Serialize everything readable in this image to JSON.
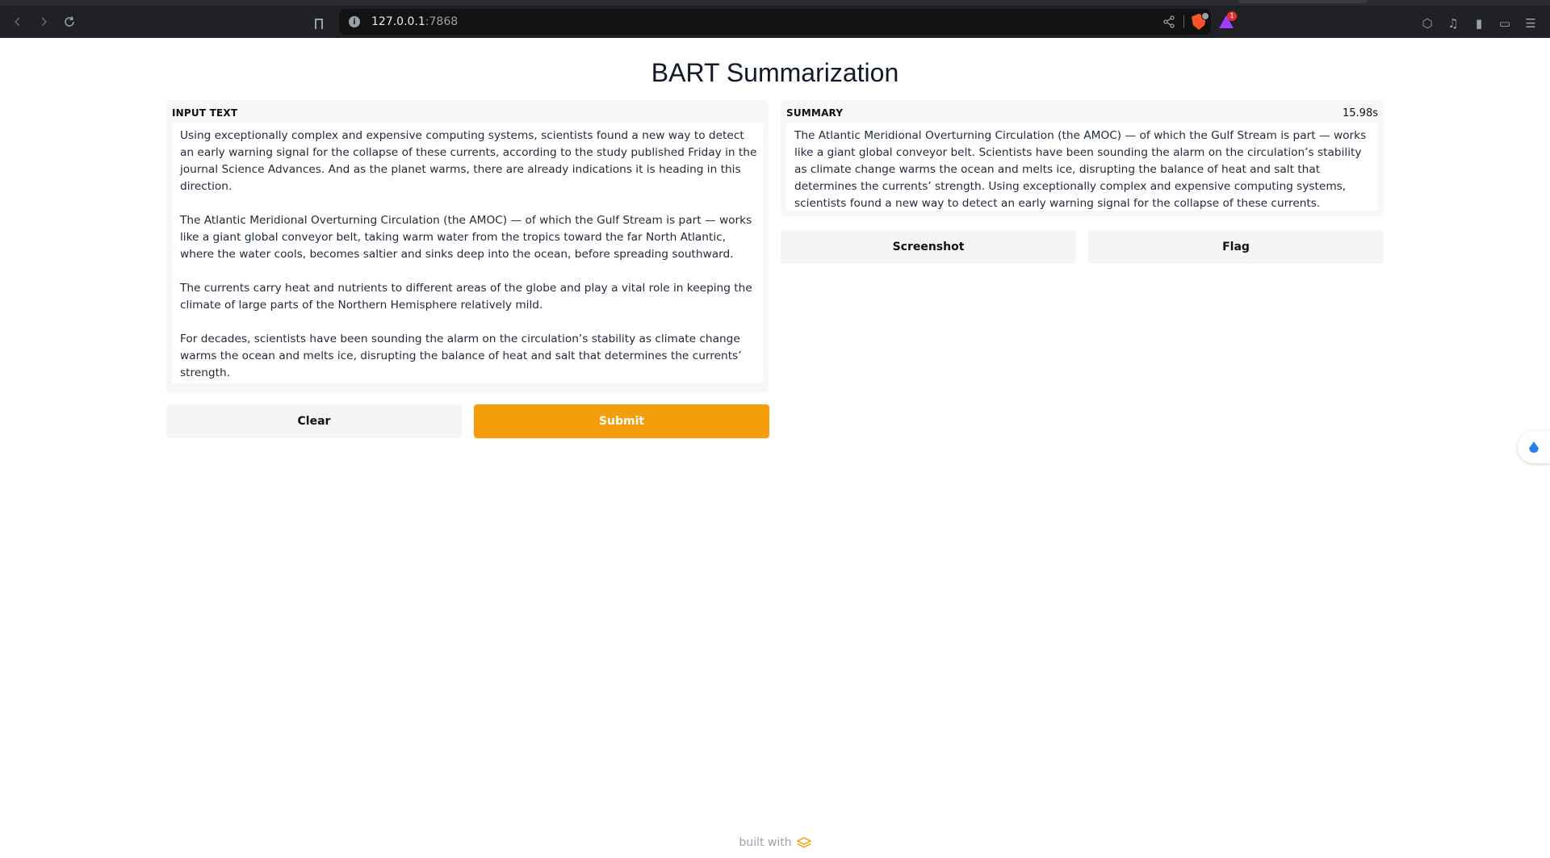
{
  "browser": {
    "url_host": "127.0.0.1",
    "url_port": ":7868",
    "rewards_badge": "1"
  },
  "app": {
    "title": "BART Summarization",
    "input": {
      "label": "Input Text",
      "paragraphs": [
        "Using exceptionally complex and expensive computing systems, scientists found a new way to detect an early warning signal for the collapse of these currents, according to the study published Friday in the journal Science Advances. And as the planet warms, there are already indications it is heading in this direction.",
        "The Atlantic Meridional Overturning Circulation (the AMOC) — of which the Gulf Stream is part — works like a giant global conveyor belt, taking warm water from the tropics toward the far North Atlantic, where the water cools, becomes saltier and sinks deep into the ocean, before spreading southward.",
        "The currents carry heat and nutrients to different areas of the globe and play a vital role in keeping the climate of large parts of the Northern Hemisphere relatively mild.",
        "For decades, scientists have been sounding the alarm on the circulation’s stability as climate change warms the ocean and melts ice, disrupting the balance of heat and salt that determines the currents’ strength."
      ]
    },
    "output": {
      "label": "Summary",
      "timer": "15.98s",
      "text": "The Atlantic Meridional Overturning Circulation (the AMOC) — of which the Gulf Stream is part — works like a giant global conveyor belt. Scientists have been sounding the alarm on the circulation’s stability as climate change warms the ocean and melts ice, disrupting the balance of heat and salt that determines the currents’ strength. Using exceptionally complex and expensive computing systems, scientists found a new way to detect an early warning signal for the collapse of these currents."
    },
    "buttons": {
      "clear": "Clear",
      "submit": "Submit",
      "screenshot": "Screenshot",
      "flag": "Flag"
    },
    "footer": {
      "built_with": "built with"
    }
  },
  "colors": {
    "primary": "#f59e0b",
    "panel_bg": "#f6f7f9",
    "chrome_bg": "#202124"
  }
}
